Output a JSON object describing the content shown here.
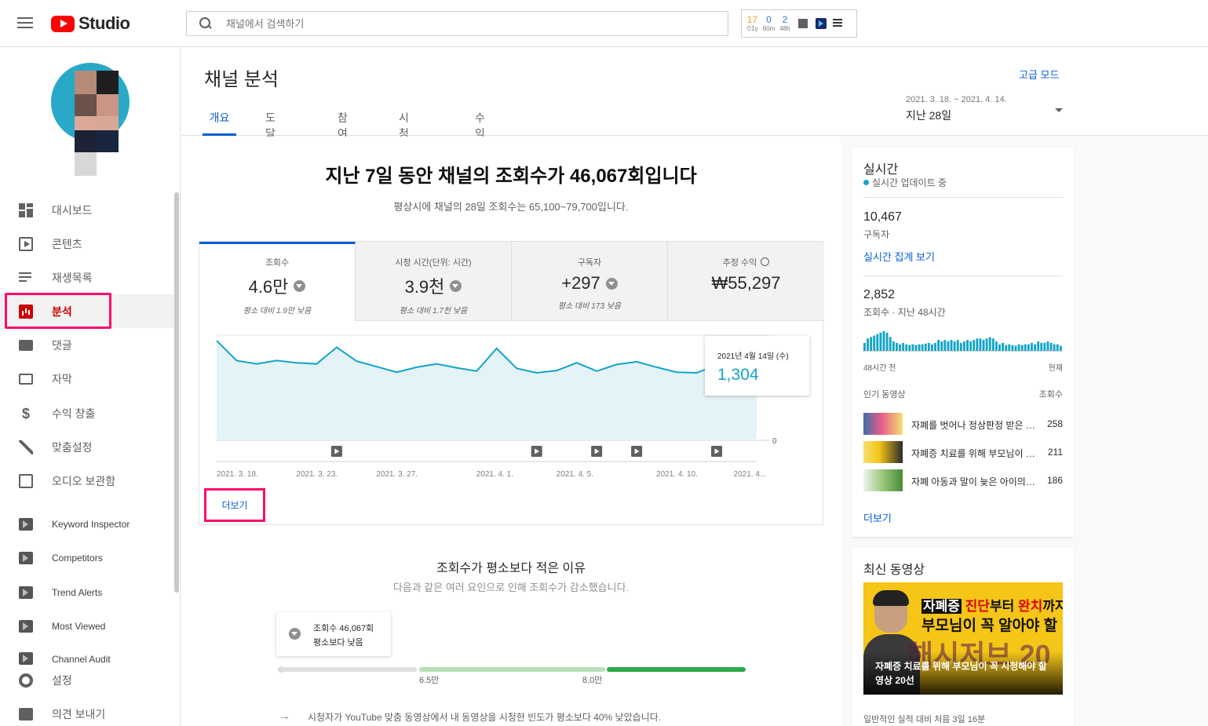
{
  "header": {
    "logo_text": "Studio",
    "search_placeholder": "채널에서 검색하기",
    "ext_widget": [
      {
        "value": "17",
        "label": "⏱1y"
      },
      {
        "value": "0",
        "label": "60m"
      },
      {
        "value": "2",
        "label": "48h"
      }
    ]
  },
  "sidebar": {
    "items": [
      {
        "label": "대시보드",
        "icon": "dashboard-icon"
      },
      {
        "label": "콘텐츠",
        "icon": "content-icon"
      },
      {
        "label": "재생목록",
        "icon": "playlist-icon"
      },
      {
        "label": "분석",
        "icon": "analytics-icon",
        "active": true
      },
      {
        "label": "댓글",
        "icon": "comment-icon"
      },
      {
        "label": "자막",
        "icon": "subtitle-icon"
      },
      {
        "label": "수익 창출",
        "icon": "dollar-icon"
      },
      {
        "label": "맞춤설정",
        "icon": "wand-icon"
      },
      {
        "label": "오디오 보관함",
        "icon": "audio-library-icon"
      },
      {
        "label": "Keyword Inspector",
        "icon": "extension-icon"
      },
      {
        "label": "Competitors",
        "icon": "extension-icon"
      },
      {
        "label": "Trend Alerts",
        "icon": "extension-icon"
      },
      {
        "label": "Most Viewed",
        "icon": "extension-icon"
      },
      {
        "label": "Channel Audit",
        "icon": "extension-icon"
      },
      {
        "label": "설정",
        "icon": "gear-icon"
      },
      {
        "label": "의견 보내기",
        "icon": "feedback-icon"
      }
    ]
  },
  "page": {
    "title": "채널 분석",
    "advanced_mode": "고급 모드",
    "tabs": [
      "개요",
      "도달범위",
      "참여도",
      "시청자층",
      "수익"
    ],
    "date_range": "2021. 3. 18. ~ 2021. 4. 14.",
    "date_label": "지난 28일"
  },
  "overview": {
    "headline": "지난 7일 동안 채널의 조회수가 46,067회입니다",
    "subline": "평상시에 채널의 28일 조회수는 65,100~79,700입니다.",
    "metrics": [
      {
        "label": "조회수",
        "value": "4.6만",
        "note": "평소 대비 1.9만 낮음",
        "trend": "down"
      },
      {
        "label": "시청 시간(단위: 시간)",
        "value": "3.9천",
        "note": "평소 대비 1.7천 낮음",
        "trend": "down"
      },
      {
        "label": "구독자",
        "value": "+297",
        "note": "평소 대비 173 낮음",
        "trend": "down"
      },
      {
        "label": "추정 수익",
        "value": "₩55,297",
        "note": "",
        "trend": "none"
      }
    ],
    "tooltip": {
      "date": "2021년 4월 14일 (수)",
      "value": "1,304"
    },
    "more_label": "더보기"
  },
  "chart_data": {
    "type": "area",
    "title": "",
    "xlabel": "",
    "ylabel": "",
    "ylim": [
      0,
      1900
    ],
    "y_ticks": [
      "1,000",
      "0"
    ],
    "x_tick_labels": [
      "2021. 3. 18.",
      "2021. 3. 23.",
      "2021. 3. 27.",
      "2021. 4. 1.",
      "2021. 4. 5.",
      "2021. 4. 10.",
      "2021. 4..."
    ],
    "x": [
      "3/18",
      "3/19",
      "3/20",
      "3/21",
      "3/22",
      "3/23",
      "3/24",
      "3/25",
      "3/26",
      "3/27",
      "3/28",
      "3/29",
      "3/30",
      "3/31",
      "4/1",
      "4/2",
      "4/3",
      "4/4",
      "4/5",
      "4/6",
      "4/7",
      "4/8",
      "4/9",
      "4/10",
      "4/11",
      "4/12",
      "4/13",
      "4/14"
    ],
    "series": [
      {
        "values": [
          1800,
          1440,
          1380,
          1440,
          1400,
          1380,
          1680,
          1430,
          1330,
          1230,
          1320,
          1380,
          1310,
          1250,
          1660,
          1300,
          1220,
          1260,
          1400,
          1250,
          1370,
          1420,
          1320,
          1230,
          1220,
          1360,
          1450,
          1304
        ]
      }
    ],
    "video_markers": [
      "3/24",
      "4/3",
      "4/6",
      "4/8",
      "4/12"
    ],
    "color": "#12a4c8"
  },
  "reasons": {
    "title": "조회수가 평소보다 적은 이유",
    "subtitle": "다음과 같은 여러 요인으로 인해 조회수가 감소했습니다.",
    "tip_line1": "조회수 46,067회",
    "tip_line2": "평소보다 낮음",
    "range_low": "6.5만",
    "range_high": "8.0만",
    "row1": "시청자가 YouTube 맞춤 동영상에서 내 동영상을 시청한 빈도가 평소보다 40% 낮았습니다."
  },
  "realtime": {
    "title": "실시간",
    "live_label": "실시간 업데이트 중",
    "subscribers_value": "10,467",
    "subscribers_label": "구독자",
    "view_count_link": "실시간 집계 보기",
    "views_value": "2,852",
    "views_label": "조회수 · 지난 48시간",
    "axis_left": "48시간 전",
    "axis_right": "현재",
    "hourly_views": [
      12,
      18,
      20,
      22,
      24,
      26,
      28,
      26,
      20,
      14,
      12,
      10,
      12,
      10,
      9,
      10,
      9,
      10,
      10,
      11,
      12,
      10,
      12,
      16,
      14,
      16,
      14,
      16,
      14,
      16,
      12,
      14,
      16,
      14,
      16,
      18,
      18,
      16,
      18,
      20,
      18,
      14,
      10,
      12,
      9,
      10,
      9,
      8,
      10,
      9,
      10,
      10,
      12,
      10,
      14,
      12,
      12,
      14,
      12,
      10,
      10,
      8
    ],
    "top_videos_header": "인기 동영상",
    "views_header": "조회수",
    "top_videos": [
      {
        "title": "자폐를 벗어나 정상판정 받은 아이",
        "count": "258"
      },
      {
        "title": "자폐증 치료를 위해 부모님이 꼭 시청해야 할 영상",
        "count": "211"
      },
      {
        "title": "자폐 아동과 말이 늦은 아이의 차이",
        "count": "186"
      }
    ],
    "more_label": "더보기"
  },
  "latest": {
    "title": "최신 동영상",
    "thumb_line1_box": "자폐증",
    "thumb_line1_a": "진단",
    "thumb_line1_b": "부터",
    "thumb_line1_c": "완치",
    "thumb_line1_d": "까지",
    "thumb_line2": "부모님이 꼭 알아야 할",
    "thumb_big": "해시저브 20",
    "caption": "자폐증 치료를 위해 부모님이 꼭 시청해야 할 영상 20선",
    "footer": "일반적인 실적 대비 처음 3일 16분"
  }
}
